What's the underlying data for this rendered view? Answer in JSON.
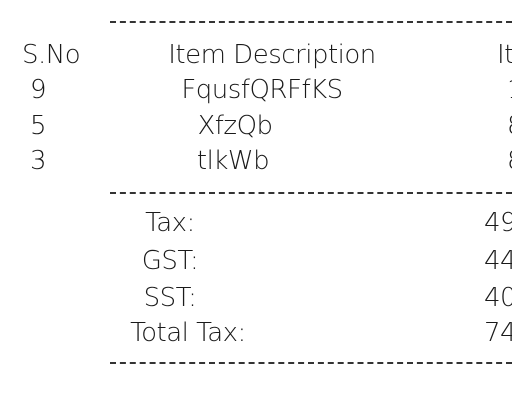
{
  "table": {
    "headers": {
      "sno": "S.No",
      "description": "Item Description",
      "item_partial": "It"
    },
    "rows": [
      {
        "sno": "9",
        "description": "FqusfQRFfKS",
        "partial": "1"
      },
      {
        "sno": "5",
        "description": "XfzQb",
        "partial": "8"
      },
      {
        "sno": "3",
        "description": "tlkWb",
        "partial": "8"
      }
    ]
  },
  "summary": [
    {
      "label": "Tax:",
      "value_partial": "49"
    },
    {
      "label": "GST:",
      "value_partial": "44"
    },
    {
      "label": "SST:",
      "value_partial": "40"
    },
    {
      "label": "Total Tax:",
      "value_partial": "74"
    }
  ]
}
